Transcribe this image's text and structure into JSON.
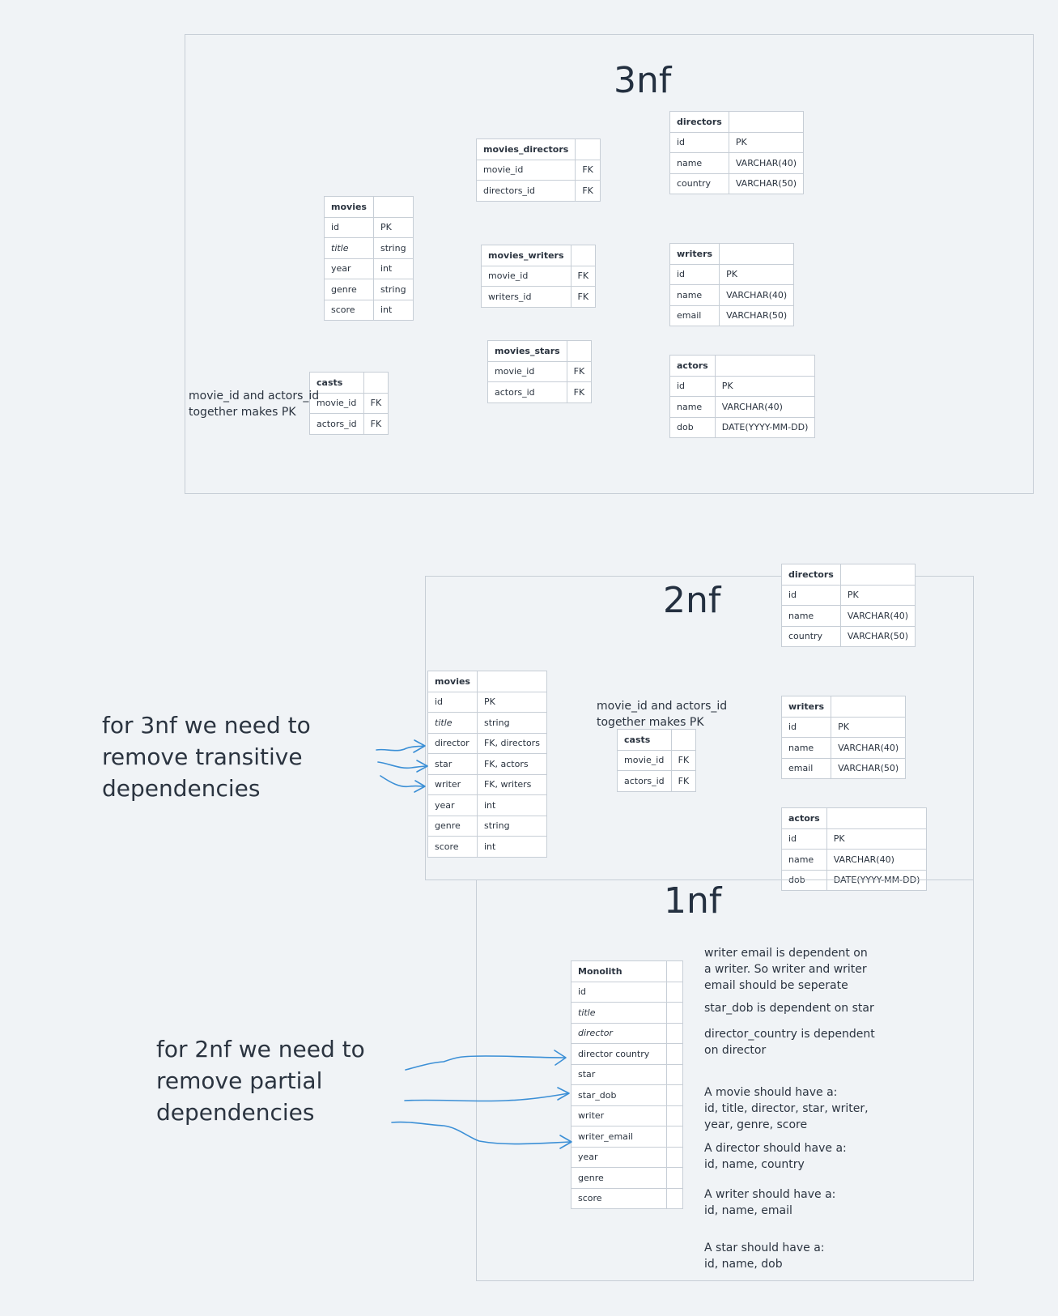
{
  "frames": {
    "f3nf": {
      "title": "3nf",
      "note": [
        "movie_id and actors_id",
        "together makes PK"
      ],
      "tables": {
        "directors": {
          "header": [
            "directors",
            ""
          ],
          "rows": [
            [
              "id",
              "PK"
            ],
            [
              "name",
              "VARCHAR(40)"
            ],
            [
              "country",
              "VARCHAR(50)"
            ]
          ]
        },
        "movies_directors": {
          "header": [
            "movies_directors",
            ""
          ],
          "rows": [
            [
              "movie_id",
              "FK"
            ],
            [
              "directors_id",
              "FK"
            ]
          ]
        },
        "movies": {
          "header": [
            "movies",
            ""
          ],
          "rows": [
            [
              "id",
              "PK"
            ],
            [
              "title",
              "string"
            ],
            [
              "year",
              "int"
            ],
            [
              "genre",
              "string"
            ],
            [
              "score",
              "int"
            ]
          ]
        },
        "movies_writers": {
          "header": [
            "movies_writers",
            ""
          ],
          "rows": [
            [
              "movie_id",
              "FK"
            ],
            [
              "writers_id",
              "FK"
            ]
          ]
        },
        "writers": {
          "header": [
            "writers",
            ""
          ],
          "rows": [
            [
              "id",
              "PK"
            ],
            [
              "name",
              "VARCHAR(40)"
            ],
            [
              "email",
              "VARCHAR(50)"
            ]
          ]
        },
        "movies_stars": {
          "header": [
            "movies_stars",
            ""
          ],
          "rows": [
            [
              "movie_id",
              "FK"
            ],
            [
              "actors_id",
              "FK"
            ]
          ]
        },
        "actors": {
          "header": [
            "actors",
            ""
          ],
          "rows": [
            [
              "id",
              "PK"
            ],
            [
              "name",
              "VARCHAR(40)"
            ],
            [
              "dob",
              "DATE(YYYY-MM-DD)"
            ]
          ]
        },
        "casts": {
          "header": [
            "casts",
            ""
          ],
          "rows": [
            [
              "movie_id",
              "FK"
            ],
            [
              "actors_id",
              "FK"
            ]
          ]
        }
      }
    },
    "f2nf": {
      "title": "2nf",
      "note": [
        "movie_id and actors_id",
        "together makes PK"
      ],
      "tables": {
        "directors": {
          "header": [
            "directors",
            ""
          ],
          "rows": [
            [
              "id",
              "PK"
            ],
            [
              "name",
              "VARCHAR(40)"
            ],
            [
              "country",
              "VARCHAR(50)"
            ]
          ]
        },
        "movies": {
          "header": [
            "movies",
            ""
          ],
          "rows": [
            [
              "id",
              "PK"
            ],
            [
              "title",
              "string"
            ],
            [
              "director",
              "FK, directors"
            ],
            [
              "star",
              "FK, actors"
            ],
            [
              "writer",
              "FK, writers"
            ],
            [
              "year",
              "int"
            ],
            [
              "genre",
              "string"
            ],
            [
              "score",
              "int"
            ]
          ]
        },
        "writers": {
          "header": [
            "writers",
            ""
          ],
          "rows": [
            [
              "id",
              "PK"
            ],
            [
              "name",
              "VARCHAR(40)"
            ],
            [
              "email",
              "VARCHAR(50)"
            ]
          ]
        },
        "casts": {
          "header": [
            "casts",
            ""
          ],
          "rows": [
            [
              "movie_id",
              "FK"
            ],
            [
              "actors_id",
              "FK"
            ]
          ]
        },
        "actors": {
          "header": [
            "actors",
            ""
          ],
          "rows": [
            [
              "id",
              "PK"
            ],
            [
              "name",
              "VARCHAR(40)"
            ],
            [
              "dob",
              "DATE(YYYY-MM-DD)"
            ]
          ]
        }
      }
    },
    "f1nf": {
      "title": "1nf",
      "tables": {
        "monolith": {
          "header": [
            "Monolith",
            ""
          ],
          "rows": [
            [
              "id",
              ""
            ],
            [
              "title",
              ""
            ],
            [
              "director",
              ""
            ],
            [
              "director country",
              ""
            ],
            [
              "star",
              ""
            ],
            [
              "star_dob",
              ""
            ],
            [
              "writer",
              ""
            ],
            [
              "writer_email",
              ""
            ],
            [
              "year",
              ""
            ],
            [
              "genre",
              ""
            ],
            [
              "score",
              ""
            ]
          ]
        }
      },
      "notes": [
        [
          "writer email is dependent on",
          "a writer. So writer and writer",
          "email should be seperate"
        ],
        [
          "star_dob is dependent on star"
        ],
        [
          "director_country is dependent",
          "on director"
        ],
        [
          "A movie should have a:",
          " id, title, director, star, writer,",
          "year, genre, score"
        ],
        [
          "A director should have a:",
          " id, name, country"
        ],
        [
          "A writer should have a:",
          " id, name, email"
        ],
        [
          "A star should have a:",
          " id, name, dob"
        ]
      ]
    }
  },
  "annotations": {
    "third": [
      "for 3nf we need to",
      "remove transitive",
      "dependencies"
    ],
    "second": [
      "for 2nf we need to",
      "remove partial",
      "dependencies"
    ]
  },
  "colors": {
    "background": "#f0f3f6",
    "border": "#c7ced6",
    "arrow": "#3b8fd6"
  }
}
